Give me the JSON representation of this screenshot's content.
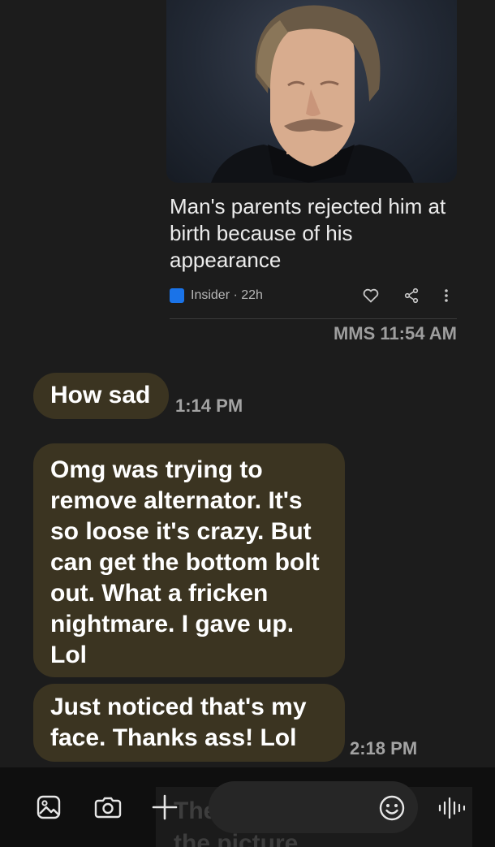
{
  "news_card": {
    "title": "Man's parents rejected him at birth because of his appearance",
    "source": "Insider · 22h",
    "icons": [
      "heart-icon",
      "share-icon",
      "more-vertical-icon"
    ]
  },
  "mms_timestamp": "MMS 11:54 AM",
  "messages": [
    {
      "text": "How sad",
      "time": "1:14 PM"
    },
    {
      "text": "Omg was trying to remove alternator. It's so loose it's crazy. But can get the bottom bolt out. What a fricken nightmare. I gave up. Lol",
      "time": ""
    },
    {
      "text": "Just noticed that's my face. Thanks ass! Lol",
      "time": "2:18 PM"
    }
  ],
  "input_bar": {
    "placeholder": "",
    "background_text": "The\nthe picture",
    "icons": [
      "gallery-icon",
      "camera-icon",
      "plus-icon",
      "emoji-icon",
      "voice-icon"
    ]
  },
  "colors": {
    "background": "#1c1c1c",
    "bubble": "#3b3421",
    "timestamp": "#a3a3a3",
    "source_logo": "#1a73e8"
  }
}
